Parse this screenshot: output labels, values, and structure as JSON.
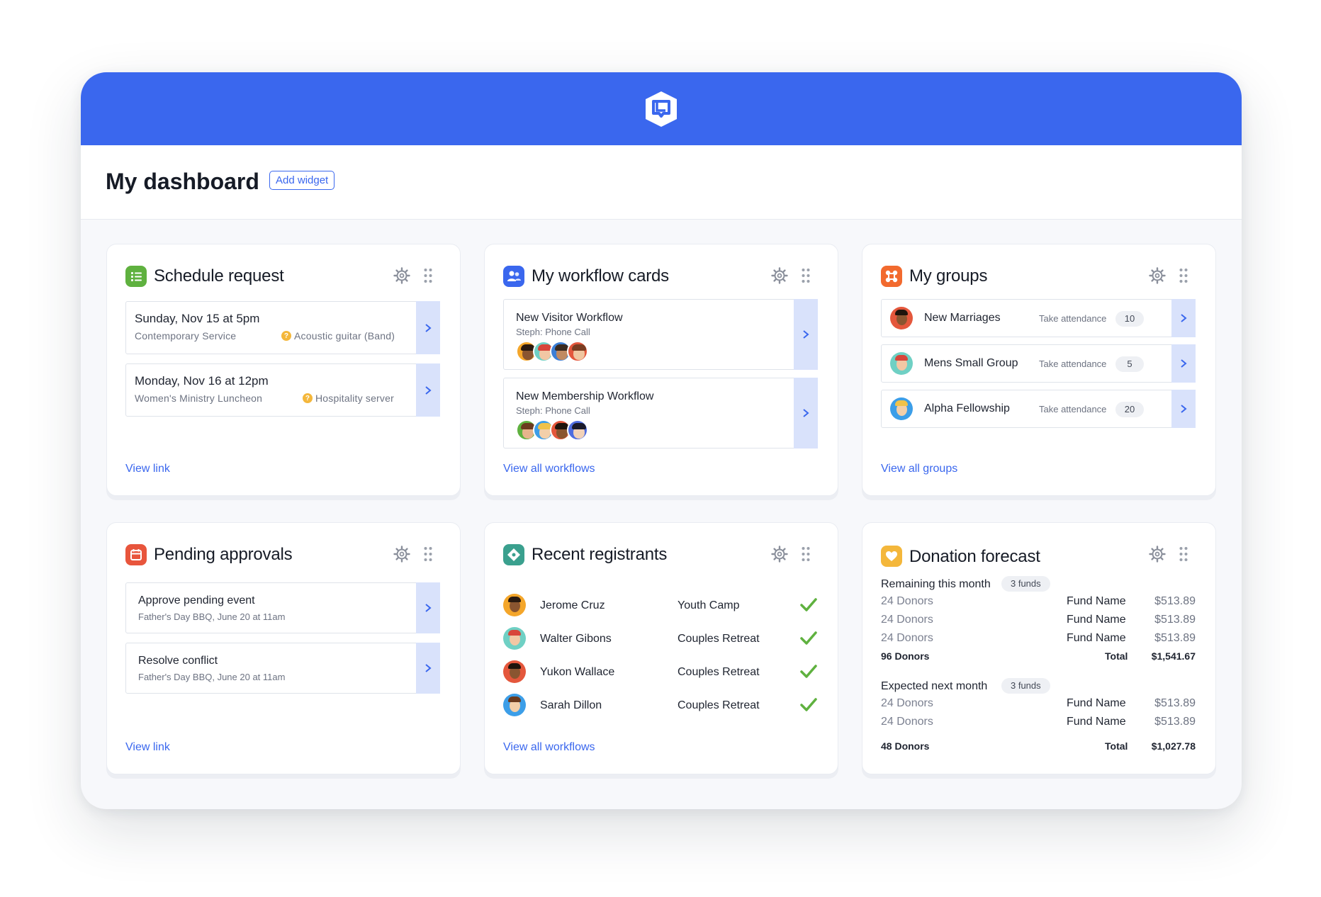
{
  "page": {
    "title": "My dashboard",
    "add_widget_label": "Add widget"
  },
  "widgets": {
    "schedule": {
      "title": "Schedule request",
      "items": [
        {
          "title": "Sunday, Nov 15 at 5pm",
          "sub": "Contemporary Service",
          "role": "Acoustic guitar (Band)"
        },
        {
          "title": "Monday, Nov 16 at 12pm",
          "sub": "Women's Ministry Luncheon",
          "role": "Hospitality server"
        }
      ],
      "link": "View link"
    },
    "workflow": {
      "title": "My workflow cards",
      "items": [
        {
          "title": "New Visitor Workflow",
          "sub": "Steph: Phone Call"
        },
        {
          "title": "New Membership Workflow",
          "sub": "Steph: Phone Call"
        }
      ],
      "link": "View all workflows"
    },
    "groups": {
      "title": "My groups",
      "action_label": "Take attendance",
      "items": [
        {
          "name": "New Marriages",
          "count": "10"
        },
        {
          "name": "Mens Small Group",
          "count": "5"
        },
        {
          "name": "Alpha Fellowship",
          "count": "20"
        }
      ],
      "link": "View all groups"
    },
    "pending": {
      "title": "Pending approvals",
      "items": [
        {
          "title": "Approve pending event",
          "sub": "Father's Day BBQ, June 20 at 11am"
        },
        {
          "title": "Resolve conflict",
          "sub": "Father's Day BBQ, June 20 at 11am"
        }
      ],
      "link": "View link"
    },
    "registrants": {
      "title": "Recent registrants",
      "items": [
        {
          "name": "Jerome Cruz",
          "event": "Youth Camp"
        },
        {
          "name": "Walter Gibons",
          "event": "Couples Retreat"
        },
        {
          "name": "Yukon Wallace",
          "event": "Couples Retreat"
        },
        {
          "name": "Sarah Dillon",
          "event": "Couples Retreat"
        }
      ],
      "link": "View all workflows"
    },
    "donation": {
      "title": "Donation forecast",
      "remaining": {
        "label": "Remaining this month",
        "badge": "3 funds",
        "rows": [
          {
            "donors": "24 Donors",
            "fund": "Fund Name",
            "amount": "$513.89"
          },
          {
            "donors": "24 Donors",
            "fund": "Fund Name",
            "amount": "$513.89"
          },
          {
            "donors": "24 Donors",
            "fund": "Fund Name",
            "amount": "$513.89"
          }
        ],
        "total_donors": "96 Donors",
        "total_label": "Total",
        "total_amount": "$1,541.67"
      },
      "expected": {
        "label": "Expected next month",
        "badge": "3 funds",
        "rows": [
          {
            "donors": "24 Donors",
            "fund": "Fund Name",
            "amount": "$513.89"
          },
          {
            "donors": "24 Donors",
            "fund": "Fund Name",
            "amount": "$513.89"
          }
        ],
        "total_donors": "48 Donors",
        "total_label": "Total",
        "total_amount": "$1,027.78"
      }
    }
  },
  "colors": {
    "brand_blue": "#3a67ee",
    "schedule_icon": "#5fb13f",
    "workflow_icon": "#3a67ee",
    "groups_icon": "#f26a2e",
    "pending_icon": "#e8553c",
    "registrants_icon": "#3aa08e",
    "donation_icon": "#f4b73b",
    "check": "#5fb13f"
  }
}
